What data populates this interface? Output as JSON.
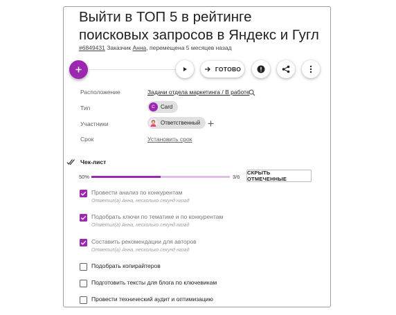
{
  "task": {
    "title": "Выйти в ТОП 5 в рейтинге поисковых запросов в Яндекс и Гугл",
    "id": "#6849431",
    "customer_label": "Заказчик",
    "customer_name": "Анна",
    "moved_text": ", перемещена 5 месяцев назад"
  },
  "toolbar": {
    "add_icon": "plus-icon",
    "play_icon": "play-icon",
    "done_label": "ГОТОВО",
    "done_icon": "arrow-right-icon",
    "alert_icon": "alert-icon",
    "share_icon": "share-icon",
    "more_icon": "more-vert-icon"
  },
  "fields": {
    "location_label": "Расположение",
    "location_value": "Задачи отдела маркетинга / В работе",
    "type_label": "Тип",
    "type_chip_letter": "C",
    "type_chip_label": "Card",
    "members_label": "Участники",
    "member_chip_label": "Ответственный",
    "due_label": "Срок",
    "due_value": "Установить срок"
  },
  "checklist": {
    "title": "Чек-лист",
    "percent": "50%",
    "progress": 0.5,
    "count": "3/6",
    "hide_button": "СКРЫТЬ ОТМЕЧЕННЫЕ",
    "items": [
      {
        "text": "Провести анализ по конкурентам",
        "checked": true,
        "note": "Отметил(а) Анна, несколько секунд назад"
      },
      {
        "text": "Подобрать ключи по тематике и по конкурентам",
        "checked": true,
        "note": "Отметил(а) Анна, несколько секунд назад"
      },
      {
        "text": "Составить рекомендации для авторов",
        "checked": true,
        "note": "Отметил(а) Анна, несколько секунд назад"
      },
      {
        "text": "Подобрать копирайтеров",
        "checked": false,
        "note": ""
      },
      {
        "text": "Подготовить тексты для блога по ключевикам",
        "checked": false,
        "note": ""
      },
      {
        "text": "Провести технический аудит и оптимизацию",
        "checked": false,
        "note": ""
      }
    ]
  },
  "colors": {
    "accent": "#9c27b0",
    "accent_light": "#e1bee7"
  }
}
